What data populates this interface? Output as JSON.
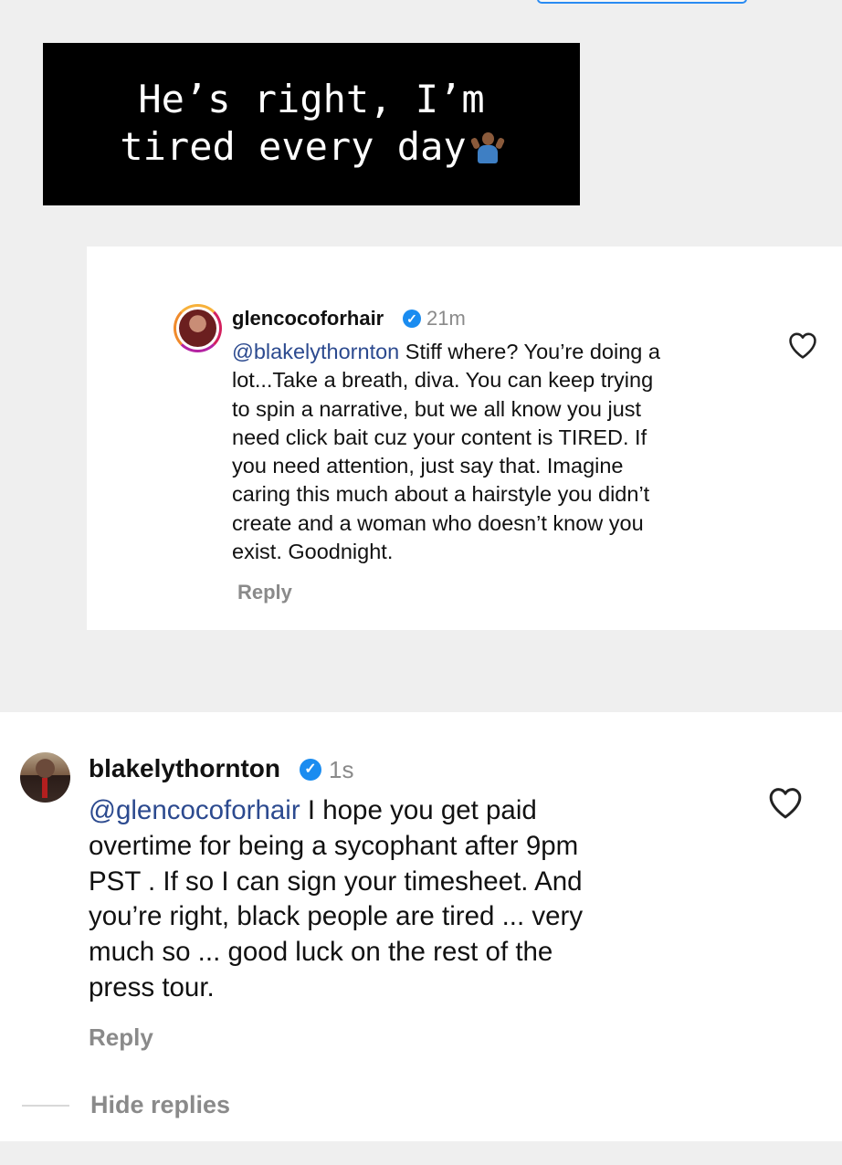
{
  "story": {
    "caption_lines": [
      "He’s right, I’m",
      "tired every day"
    ],
    "caption_icon": "shrug-emoji-icon"
  },
  "comment_1": {
    "username": "glencocoforhair",
    "timestamp": "21m",
    "mention": "@blakelythornton",
    "lines": [
      " Stiff where? You’re doing a",
      "lot...Take a breath, diva. You can keep trying",
      "to spin a narrative, but we all know you just",
      "need click bait cuz your content is TIRED. If",
      "you need attention, just say that. Imagine",
      "caring this much about a hairstyle you didn’t",
      "create and a woman who doesn’t know you",
      "exist. Goodnight."
    ],
    "reply_label": "Reply"
  },
  "comment_2": {
    "username": "blakelythornton",
    "timestamp": "1s",
    "mention": "@glencocoforhair",
    "lines": [
      " I hope you get paid",
      "overtime for being a sycophant after 9pm",
      "PST . If so I can sign your timesheet.  And",
      "you’re right, black people are tired ... very",
      "much so ... good luck on the rest of the",
      "press tour."
    ],
    "reply_label": "Reply"
  },
  "hide_replies_label": "Hide replies",
  "colors": {
    "mention": "#2c4a8f",
    "verified": "#1a8cf0",
    "muted": "#8a8a8a"
  }
}
